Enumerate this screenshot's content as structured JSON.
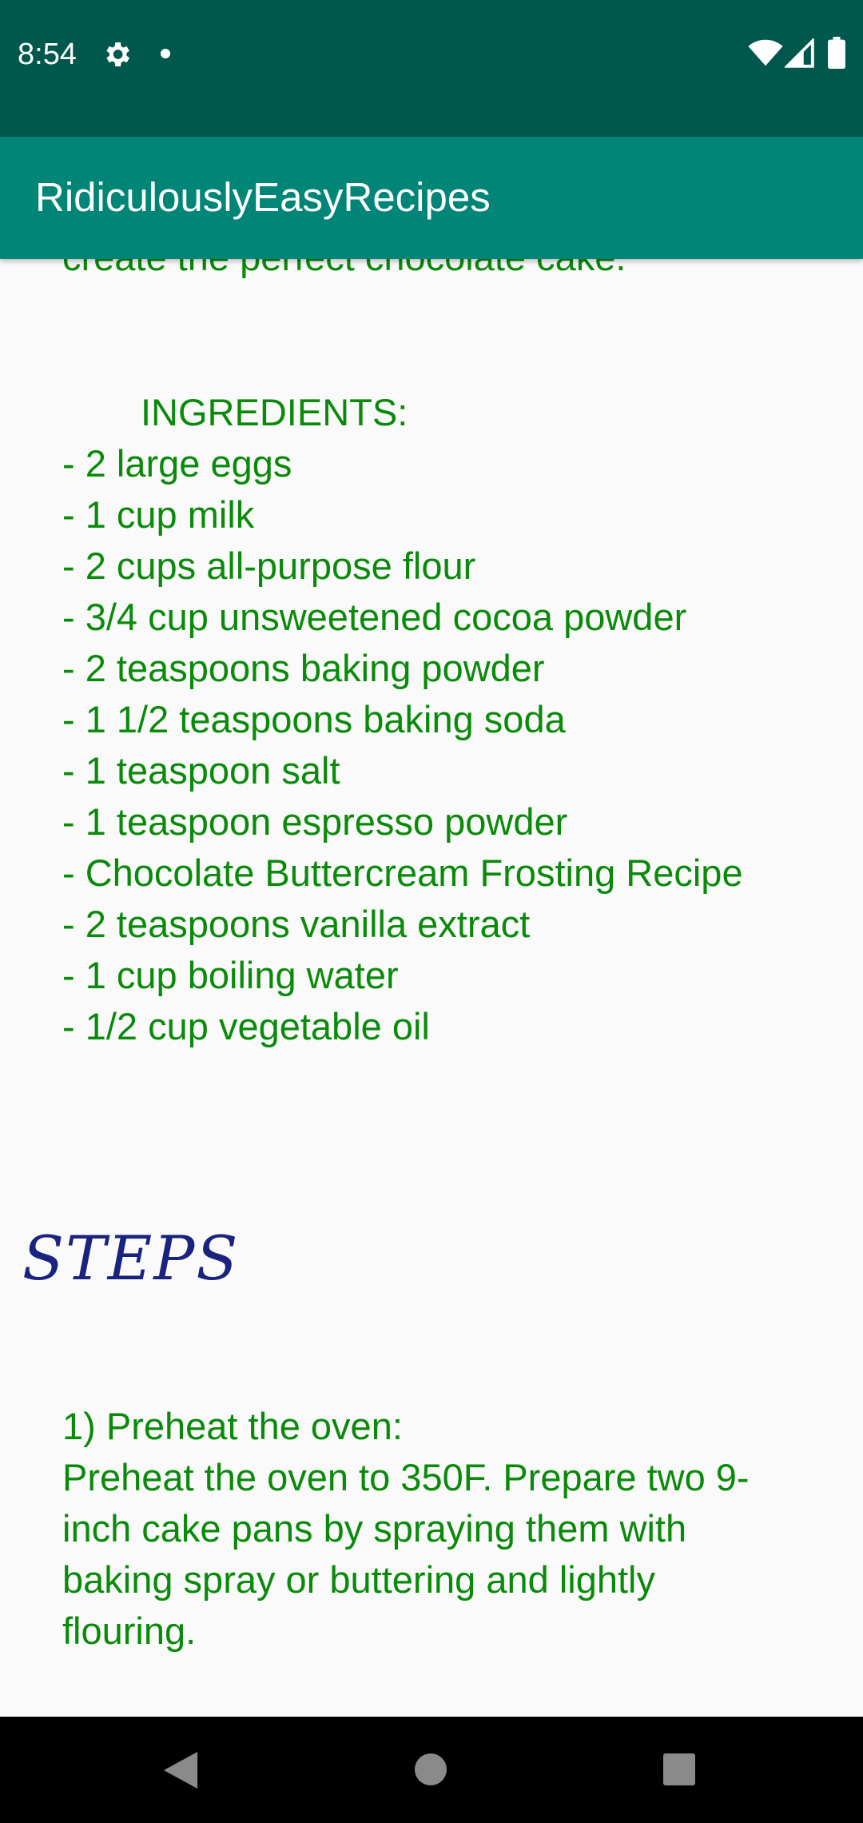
{
  "status_bar": {
    "time": "8:54",
    "icons": [
      "gear-icon",
      "notification-dot-icon",
      "wifi-icon",
      "signal-icon",
      "battery-icon"
    ],
    "background": "#00574b"
  },
  "app_bar": {
    "title": "RidiculouslyEasyRecipes",
    "background": "#008577"
  },
  "recipe": {
    "intro_partial_line": "create the perfect chocolate cake.",
    "ingredients_heading": "INGREDIENTS:",
    "ingredients": [
      "- 2 large eggs",
      "- 1 cup milk",
      "- 2 cups all-purpose flour",
      "- 3/4 cup unsweetened cocoa powder",
      "- 2 teaspoons baking powder",
      "- 1 1/2 teaspoons baking soda",
      "- 1 teaspoon salt",
      "- 1 teaspoon espresso powder",
      "- Chocolate Buttercream Frosting Recipe",
      "- 2 teaspoons vanilla extract",
      "- 1 cup boiling water",
      "- 1/2 cup vegetable oil"
    ],
    "text_color": "#0a8a0a"
  },
  "steps": {
    "heading": "STEPS",
    "heading_color": "#1a237e",
    "items": [
      {
        "title": "1) Preheat the oven:",
        "body": "Preheat the oven to 350F. Prepare two 9-inch cake pans by spraying them with baking spray or buttering and lightly flouring."
      }
    ]
  },
  "nav_bar": {
    "icons": [
      "back-icon",
      "home-icon",
      "recents-icon"
    ]
  }
}
